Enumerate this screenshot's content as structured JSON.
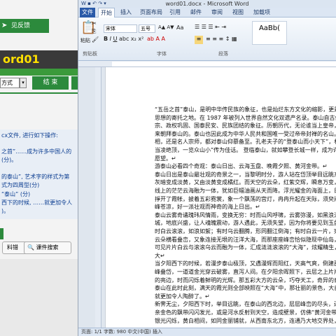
{
  "left_panel": {
    "feedback_button": "见反馈",
    "title": "ord01",
    "format_select": "方式",
    "end_button": "结 束",
    "lines": [
      "cx文件, 进行如下操作:",
      "之首”……成为许多中国人的",
      "(分)。",
      "的泰山”, 艺术字的样式为第",
      "式为四周型(分)",
      "“泰山” (分)",
      "西下的时候, ……就更加令人",
      ")。"
    ],
    "btn_kb1": "料错",
    "btn_kb2": "课件搜索"
  },
  "word": {
    "window_title": "word01.docx - Microsoft Word",
    "qat": "W ▪ ↶ ↷ ▾",
    "tabs": [
      "文件",
      "开始",
      "插入",
      "页面布局",
      "引用",
      "邮件",
      "审阅",
      "视图",
      "加载项"
    ],
    "font_name": "宋体",
    "font_size": "五号",
    "ribbon_labels": {
      "clipboard": "剪贴板",
      "font": "字体",
      "paragraph": "段落"
    },
    "style_sample": "AaBb(",
    "paragraph": [
      "“五岳之首”泰山，是明中华传民族的象征，也是灿烂东方文化的缩影，更是",
      "思想的寄托之地。在 1987 年被列入世界自然文化双遗产名录。泰山自古便被",
      "宗、政权巩固、国泰民安、民族团结的象征。历朝历代，无论谁当上皇帝，从",
      "来朝拜泰山的。泰山也因此成为中华人民共和国唯一受过帝帝封禅的名山。泰山",
      "相，还是名人宗师，都对泰山仰慕备至。孔老夫子的“登泰山而小天下”，杜",
      "当凌绝顶，一览众山小”传为佳话。 登临泰山，就如攀登长城一样，成为许多",
      "愿望。↵",
      "游泰山必看四个奇观：泰山日出、云海玉盘、晚霞夕照、黄河金带。↵",
      "泰山日出是泰山最壮观的奇景之一，当黎明时分，游人站在岱顶举目远眺东方",
      "灰暗变成淡黄，又由淡黄变成橘红。而天空的云朵，红紫交辉，瞬息万变，漫天",
      "线上的茫茫云海融为一体，犹如巨幅油画从天而降。浮光耀金的海面上，日轮掀",
      "掙开了霞帐，披着五彩霓裳，象一个飘荡的宫灯，冉冉升起在天际，须臾间，金",
      "峰苍凉，好一派壮观而神奇的海上日出。↵",
      "泰山云雾奇谲瑰玮风情雨，变换无穷：时而山风呼啸，云雾弥漫，如黑浪汹涌世界",
      "城，地底兴盛，让人魂魄震动，游人遇此，无须失望，因为你将要见到玉盘云海",
      "时白云滚滚，如浪如絮；有时乌云翻腾，形同翻江倒海；有时白云一片，宛如平",
      "云朵横看叠峦，又象连接无垠的汪洋大海，而那座座峰峦恰似隐现中仙岛，站在岱顶",
      "可见片片白云与滚滚乌云而融为一体，汇成涟涟滚滚的“大海”，炫耀精生，如同",
      "大↵",
      "当夕阳西下的时候，若漫步泰山极顶，又遇漫辉而阳红，天高气爽，倒建西天",
      "峰叠岱，一道道金光穿云破雾，直泻人间。在夕阳余晖照下，云层之上片片瞬息",
      "的亮边，时而闪烁着鲜明的光辉。那五彩大方的云朵，巧夺天工，奇异的泰山",
      "泰山在此时此刻，满天的霞光则全部映照在“大海”中，那壮丽的景色，大自然",
      "就更加令人陶醉了。↵",
      "新霁无尘，夕阳西下时，举目远眺，在泰山的西北边，层层峰峦的尽头，还可以",
      "亲金色的飘带闪闪发光，或是河水反射到天空，造成壁景，仿佛“黄河金带”",
      "银光闪烁，黄白相间，如同金丽铺就，从西南东北方，连通乃大地交界处，"
    ],
    "status_text": "页面: 1/1   字数: 980   中文(中国)   插入"
  }
}
